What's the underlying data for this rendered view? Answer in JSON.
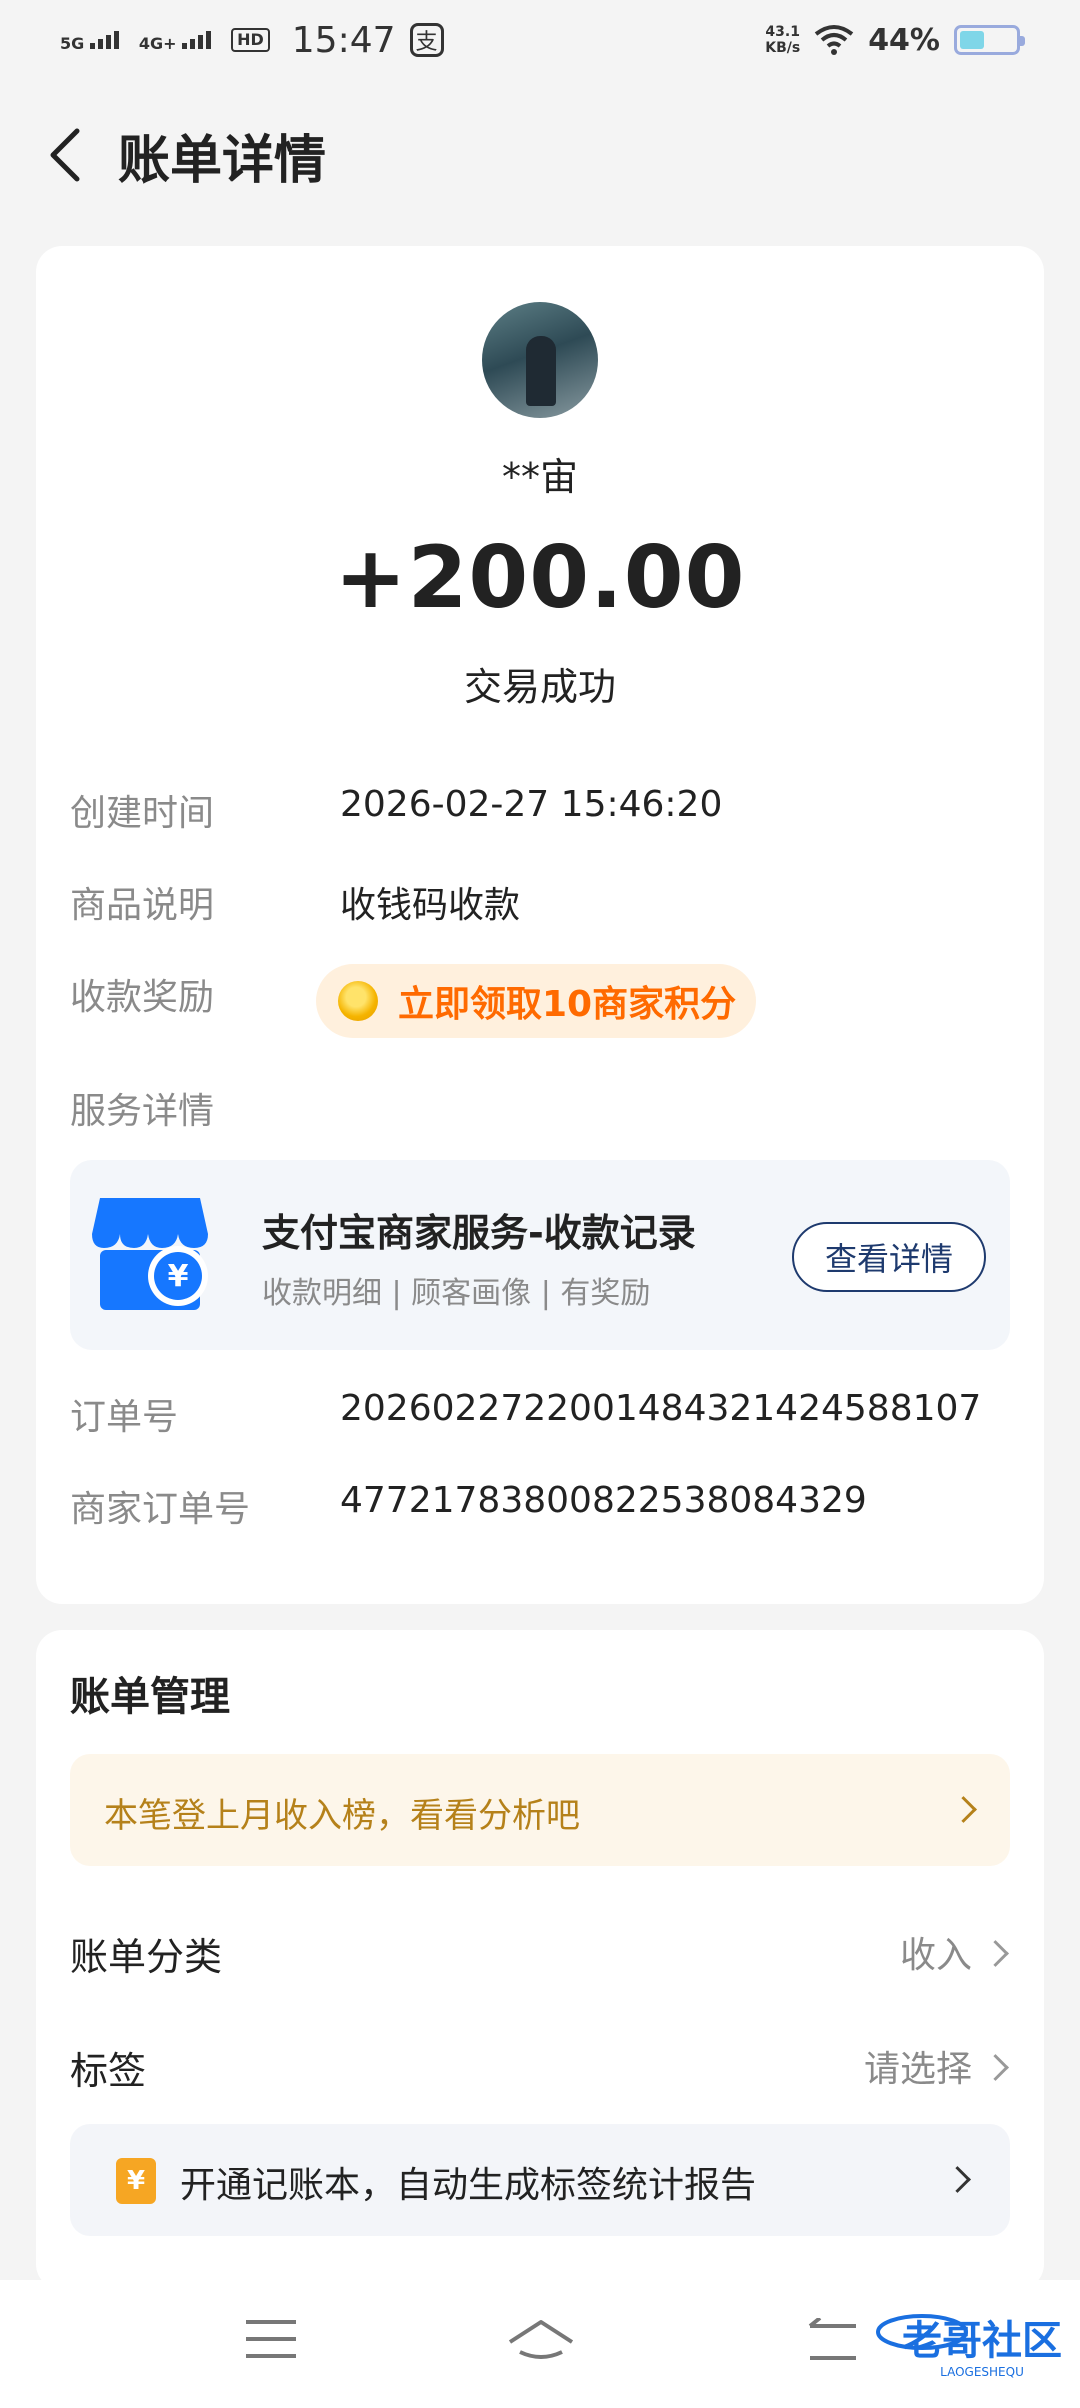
{
  "status_bar": {
    "signal1": "5G",
    "signal2": "4G+",
    "hd": "HD",
    "time": "15:47",
    "app_badge": "支",
    "speed_value": "43.1",
    "speed_unit": "KB/s",
    "battery": "44%",
    "battery_level": 0.44
  },
  "nav": {
    "title": "账单详情"
  },
  "txn": {
    "name": "**宙",
    "amount": "+200.00",
    "status": "交易成功"
  },
  "details": {
    "created_label": "创建时间",
    "created_value": "2026-02-27 15:46:20",
    "item_label": "商品说明",
    "item_value": "收钱码收款",
    "reward_label": "收款奖励",
    "reward_text": "立即领取10商家积分",
    "service_label": "服务详情",
    "order_label": "订单号",
    "order_value": "2026022722001484321424588107",
    "merchant_order_label": "商家订单号",
    "merchant_order_value": "477217838008225380843​29"
  },
  "service": {
    "title": "支付宝商家服务-收款记录",
    "subtitle": "收款明细 | 顾客画像 | 有奖励",
    "button": "查看详情"
  },
  "management": {
    "title": "账单管理",
    "promo": "本笔登上月收入榜，看看分析吧",
    "category_label": "账单分类",
    "category_value": "收入",
    "tag_label": "标签",
    "tag_value": "请选择",
    "ledger_icon": "¥",
    "ledger_text": "开通记账本，自动生成标签统计报告"
  },
  "watermark": {
    "text": "老哥社区",
    "sub": "LAOGESHEQU"
  }
}
